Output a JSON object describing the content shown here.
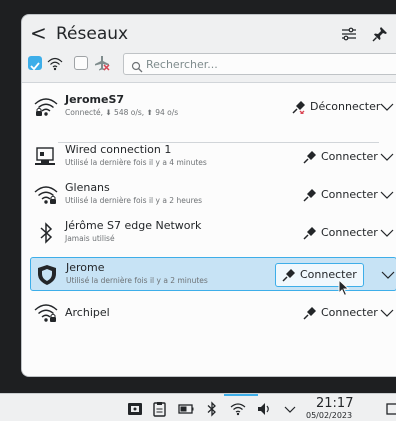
{
  "header": {
    "back": "<",
    "title": "Réseaux",
    "config_icon": "configure-icon",
    "pin_icon": "pin-icon"
  },
  "toolbar": {
    "wireless_checked": true,
    "wireless_icon": "wifi-icon",
    "airplane_checked": false,
    "airplane_icon": "airplane-mode-icon",
    "search_placeholder": "Rechercher...",
    "search_value": ""
  },
  "connections": [
    {
      "name": "JeromeS7",
      "status": "Connecté, ⬇ 548 o/s, ⬆ 94 o/s",
      "icon": "wifi-secure-icon",
      "action": "Déconnecter",
      "connected": true
    },
    {
      "name": "Wired connection 1",
      "status": "Utilisé la dernière fois il y a 4 minutes",
      "icon": "wired-network-icon",
      "action": "Connecter"
    },
    {
      "name": "Glenans",
      "status": "Utilisé la dernière fois il y a 2 heures",
      "icon": "wifi-secure-icon",
      "action": "Connecter"
    },
    {
      "name": "Jérôme S7 edge Network",
      "status": "Jamais utilisé",
      "icon": "bluetooth-icon",
      "action": "Connecter"
    },
    {
      "name": "Jerome",
      "status": "Utilisé la dernière fois il y a 2 minutes",
      "icon": "vpn-shield-icon",
      "action": "Connecter",
      "selected": true
    },
    {
      "name": "Archipel",
      "status": "",
      "icon": "wifi-secure-icon",
      "action": "Connecter"
    }
  ],
  "taskbar": {
    "tray_icons": [
      "vault-icon",
      "clipboard-icon",
      "battery-icon",
      "bluetooth-icon",
      "wifi-icon",
      "volume-icon",
      "expand-tray-icon"
    ],
    "time": "21:17",
    "date": "05/02/2023"
  },
  "colors": {
    "accent": "#3daee9",
    "selected_bg": "#c7e3f5",
    "panel_bg": "#eff0f1",
    "list_bg": "#fcfcfc",
    "text": "#232629"
  }
}
